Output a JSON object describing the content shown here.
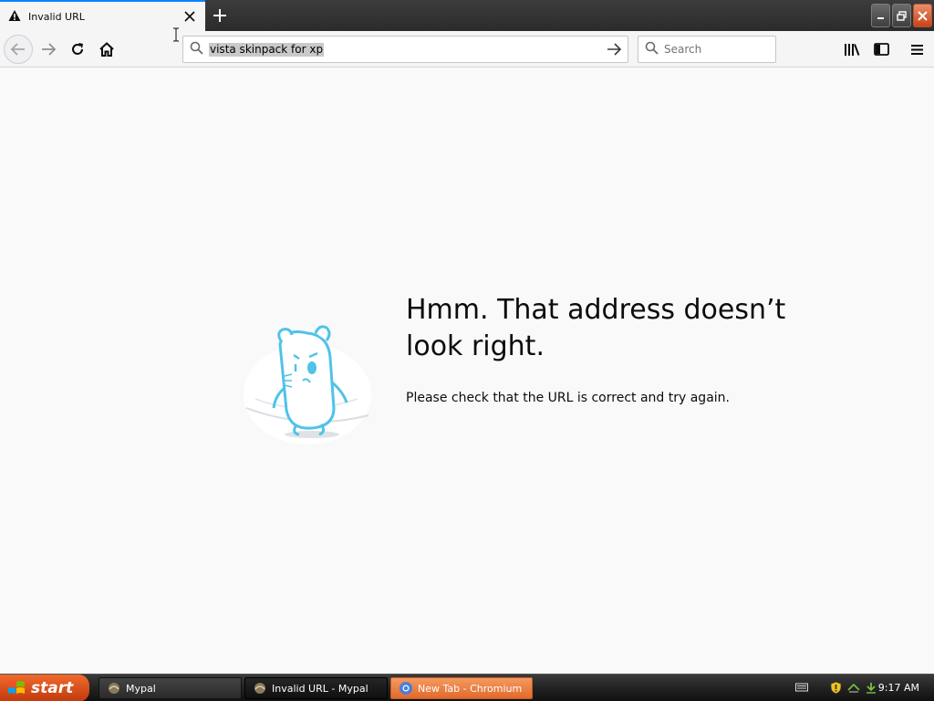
{
  "tab": {
    "title": "Invalid URL"
  },
  "urlbar": {
    "value": "vista skinpack for xp"
  },
  "search": {
    "placeholder": "Search"
  },
  "error": {
    "title": "Hmm. That address doesn’t look right.",
    "description": "Please check that the URL is correct and try again."
  },
  "taskbar": {
    "start_label": "start",
    "items": [
      {
        "label": "Mypal"
      },
      {
        "label": "Invalid URL - Mypal"
      },
      {
        "label": "New Tab - Chromium"
      }
    ],
    "clock": "9:17 AM"
  },
  "colors": {
    "accent": "#0a84ff",
    "page_bg": "#f9f9fa",
    "start_orange": "#e0531c",
    "active_task_orange": "#ec7d40",
    "illustration_blue": "#4fc3e8"
  },
  "icons": {
    "tab": "warning-icon",
    "close": "close-icon",
    "new_tab": "plus-icon",
    "back": "back-arrow-icon",
    "forward": "forward-arrow-icon",
    "reload": "reload-icon",
    "home": "home-icon",
    "url_search": "search-icon",
    "go": "go-arrow-icon",
    "library": "library-icon",
    "sidebar": "sidebar-icon",
    "menu": "hamburger-menu-icon"
  }
}
